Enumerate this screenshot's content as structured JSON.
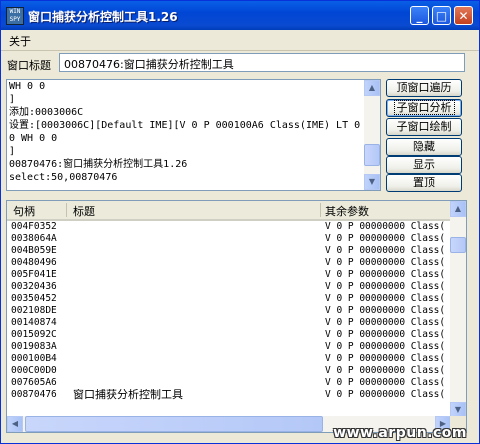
{
  "window": {
    "title": "窗口捕获分析控制工具1.26",
    "icon_text": "WIN SPY",
    "controls": {
      "minimize": "_",
      "maximize": "□",
      "close": "✕"
    }
  },
  "menu": {
    "about": "关于"
  },
  "window_title": {
    "label": "窗口标题",
    "value": "00870476:窗口捕获分析控制工具"
  },
  "log": {
    "lines": [
      "WH 0 0",
      "]",
      "添加:0003006C",
      "设置:[0003006C][Default IME][V 0 P 000100A6 Class(IME) LT 0",
      "0 WH 0 0",
      "]",
      "00870476:窗口捕获分析控制工具1.26",
      "select:50,00870476"
    ]
  },
  "buttons": {
    "top_window_traverse": "顶窗口遍历",
    "child_window_analyze": "子窗口分析",
    "child_window_draw": "子窗口绘制",
    "hide": "隐藏",
    "show": "显示",
    "set_topmost": "置顶"
  },
  "list": {
    "columns": {
      "handle": "句柄",
      "title": "标题",
      "params": "其余参数"
    },
    "rows": [
      {
        "handle": "004F0352",
        "title": "",
        "params": "V 0 P 00000000 Class("
      },
      {
        "handle": "0038064A",
        "title": "",
        "params": "V 0 P 00000000 Class("
      },
      {
        "handle": "004B059E",
        "title": "",
        "params": "V 0 P 00000000 Class("
      },
      {
        "handle": "00480496",
        "title": "",
        "params": "V 0 P 00000000 Class("
      },
      {
        "handle": "005F041E",
        "title": "",
        "params": "V 0 P 00000000 Class("
      },
      {
        "handle": "00320436",
        "title": "",
        "params": "V 0 P 00000000 Class("
      },
      {
        "handle": "00350452",
        "title": "",
        "params": "V 0 P 00000000 Class("
      },
      {
        "handle": "002108DE",
        "title": "",
        "params": "V 0 P 00000000 Class("
      },
      {
        "handle": "00140874",
        "title": "",
        "params": "V 0 P 00000000 Class("
      },
      {
        "handle": "0015092C",
        "title": "",
        "params": "V 0 P 00000000 Class("
      },
      {
        "handle": "0019083A",
        "title": "",
        "params": "V 0 P 00000000 Class("
      },
      {
        "handle": "000100B4",
        "title": "",
        "params": "V 0 P 00000000 Class("
      },
      {
        "handle": "000C00D0",
        "title": "",
        "params": "V 0 P 00000000 Class("
      },
      {
        "handle": "007605A6",
        "title": "",
        "params": "V 0 P 00000000 Class("
      },
      {
        "handle": "00870476",
        "title": "窗口捕获分析控制工具",
        "params": "V 0 P 00000000 Class("
      }
    ]
  },
  "watermark": "www.arpun.com"
}
